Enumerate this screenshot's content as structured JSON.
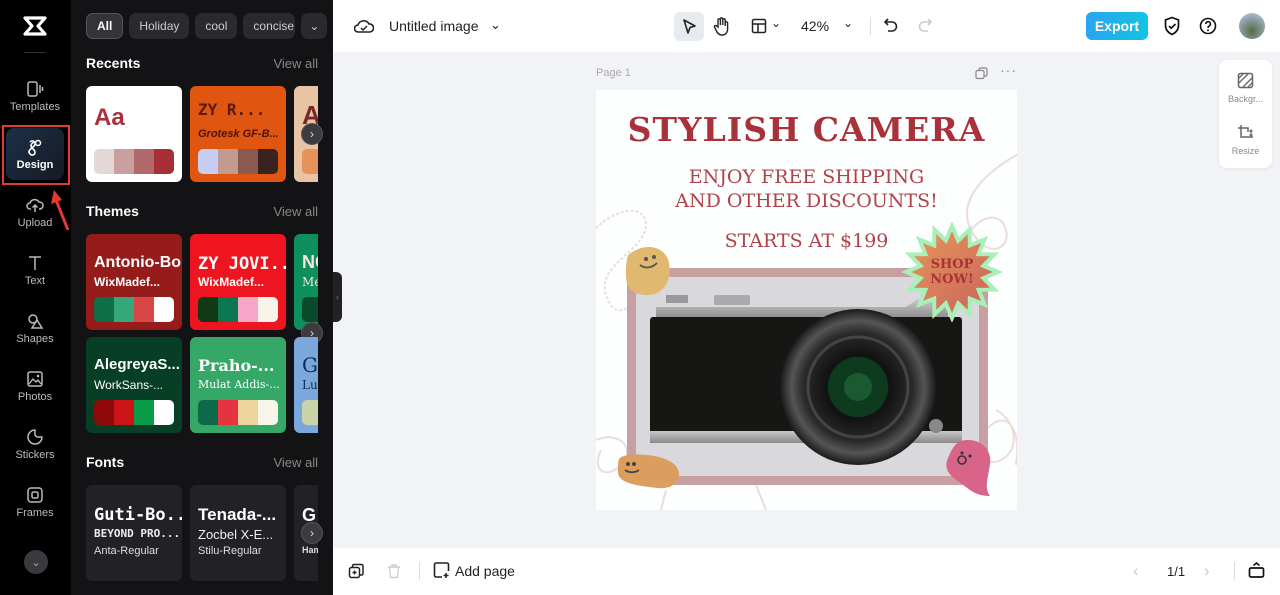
{
  "rail": {
    "items": [
      {
        "label": "Templates",
        "icon": "templates-icon"
      },
      {
        "label": "Design",
        "icon": "design-icon",
        "active": true
      },
      {
        "label": "Upload",
        "icon": "upload-icon"
      },
      {
        "label": "Text",
        "icon": "text-icon"
      },
      {
        "label": "Shapes",
        "icon": "shapes-icon"
      },
      {
        "label": "Photos",
        "icon": "photos-icon"
      },
      {
        "label": "Stickers",
        "icon": "stickers-icon"
      },
      {
        "label": "Frames",
        "icon": "frames-icon"
      }
    ],
    "more_icon": "chevron-down-icon",
    "highlight_color": "#e53935"
  },
  "panel": {
    "chips": [
      "All",
      "Holiday",
      "cool",
      "concise"
    ],
    "chips_more_icon": "chevron-down-icon",
    "recents": {
      "title": "Recents",
      "view_all": "View all",
      "cards": [
        {
          "t1": "Aa",
          "bg": "#ffffff",
          "color": "#a8313a",
          "palette": [
            "#e6d7d7",
            "#c9a09e",
            "#b06a6b",
            "#a52f35"
          ]
        },
        {
          "t1": "ZY R...",
          "t2": "Grotesk GF-B...",
          "bg": "#e05510",
          "color": "#5a1a10",
          "palette": [
            "#c6cdf0",
            "#c19a90",
            "#8a5a4f",
            "#3a2220"
          ]
        },
        {
          "t1": "A",
          "bg": "#e8c4a4",
          "color": "#7a2a26",
          "palette": [
            "#e5935a"
          ]
        }
      ]
    },
    "themes": {
      "title": "Themes",
      "view_all": "View all",
      "cards": [
        {
          "t1": "Antonio-Bold",
          "t2": "WixMadef...",
          "bg": "#961b1b",
          "color": "#ffffff",
          "palette": [
            "#0e6e48",
            "#36a779",
            "#d84646",
            "#ffffff"
          ]
        },
        {
          "t1": "ZY JOVI...",
          "t2": "WixMadef...",
          "bg": "#ee1520",
          "color": "#ffffff",
          "palette": [
            "#0f3a15",
            "#0c7650",
            "#f6a7c8",
            "#f8f4ea"
          ]
        },
        {
          "t1": "NO",
          "t2": "Me",
          "bg": "#0f8e5e",
          "color": "#f5e6dc",
          "palette": [
            "#0a4a2a"
          ]
        },
        {
          "t1": "AlegreyaS...",
          "t2": "WorkSans-...",
          "bg": "#073e26",
          "color": "#ffffff",
          "palette": [
            "#8e0a0a",
            "#cc1417",
            "#099b47",
            "#ffffff"
          ]
        },
        {
          "t1": "Praho-...",
          "t2": "Mulat Addis-...",
          "bg": "#35a867",
          "color": "#ffffff",
          "palette": [
            "#0c6a48",
            "#e53340",
            "#ecd49d",
            "#f8f6ea"
          ]
        },
        {
          "t1": "G",
          "t2": "Lu",
          "bg": "#7ba8dc",
          "color": "#0d2e52",
          "palette": [
            "#c9d4a8"
          ]
        }
      ]
    },
    "fonts": {
      "title": "Fonts",
      "view_all": "View all",
      "cards": [
        {
          "f1": "Guti-Bo...",
          "f2": "BEYOND PRO...",
          "f3": "Anta-Regular"
        },
        {
          "f1": "Tenada-...",
          "f2": "Zocbel X-E...",
          "f3": "Stilu-Regular"
        },
        {
          "f1": "G",
          "f2": "",
          "f3": "Ham"
        }
      ]
    }
  },
  "topbar": {
    "cloud_icon": "cloud-saved-icon",
    "doc_title": "Untitled image",
    "zoom": "42%",
    "export_label": "Export",
    "export_color": "#1fb4ec"
  },
  "canvas": {
    "page_label": "Page 1",
    "poster": {
      "title": "STYLISH CAMERA",
      "line1": "ENJOY FREE SHIPPING",
      "line2": "AND OTHER DISCOUNTS!",
      "price": "STARTS AT $199",
      "badge_line1": "SHOP",
      "badge_line2": "NOW!",
      "accent": "#a8313a"
    }
  },
  "sidepanel": {
    "items": [
      {
        "label": "Backgr...",
        "icon": "background-icon"
      },
      {
        "label": "Resize",
        "icon": "resize-icon"
      }
    ]
  },
  "bottombar": {
    "add_page": "Add page",
    "pager": "1/1"
  }
}
